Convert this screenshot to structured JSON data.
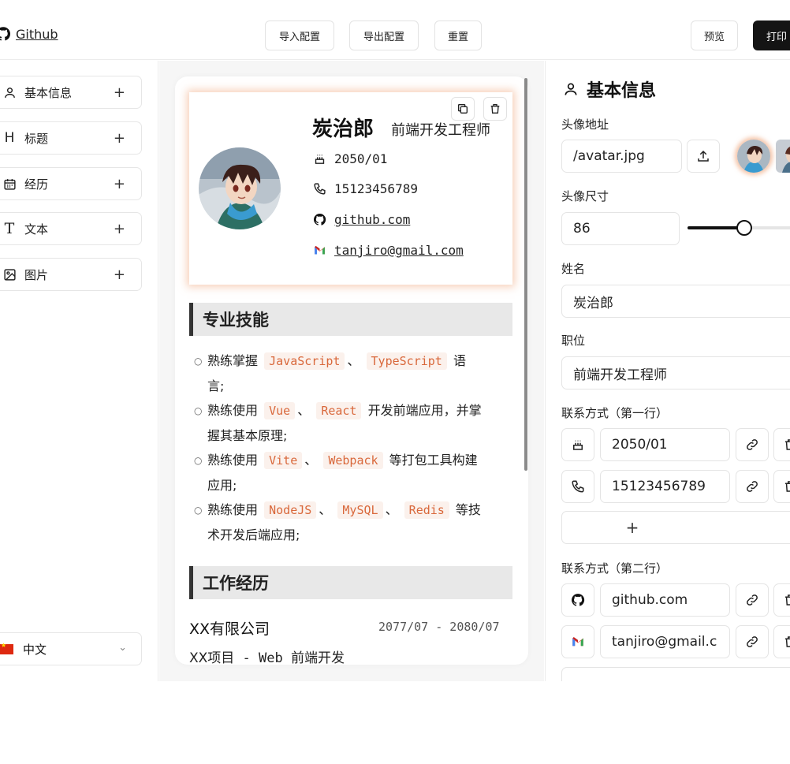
{
  "header": {
    "github_label": "Github",
    "import_label": "导入配置",
    "export_label": "导出配置",
    "reset_label": "重置",
    "preview_label": "预览",
    "print_label": "打印"
  },
  "sidebar": {
    "items": [
      {
        "label": "基本信息",
        "icon": "user-icon"
      },
      {
        "label": "标题",
        "icon": "heading-icon"
      },
      {
        "label": "经历",
        "icon": "calendar-icon"
      },
      {
        "label": "文本",
        "icon": "text-icon"
      },
      {
        "label": "图片",
        "icon": "image-icon"
      }
    ],
    "language": "中文"
  },
  "resume": {
    "name": "炭治郎",
    "title": "前端开发工程师",
    "birth": "2050/01",
    "phone": "15123456789",
    "github": "github.com",
    "email": "tanjiro@gmail.com",
    "skills_heading": "专业技能",
    "skills": [
      {
        "pre": "熟练掌握",
        "t1": "JavaScript",
        "sep": "、",
        "t2": "TypeScript",
        "post1": "语",
        "post2": "言;"
      },
      {
        "pre": "熟练使用",
        "t1": "Vue",
        "sep": "、",
        "t2": "React",
        "post1": "开发前端应用，并掌",
        "post2": "握其基本原理;"
      },
      {
        "pre": "熟练使用",
        "t1": "Vite",
        "sep": "、",
        "t2": "Webpack",
        "post1": "等打包工具构建",
        "post2": "应用;"
      },
      {
        "pre": "熟练使用",
        "t1": "NodeJS",
        "sep": "、",
        "t2": "MySQL",
        "sep2": "、",
        "t3": "Redis",
        "post1": "等技",
        "post2": "术开发后端应用;"
      }
    ],
    "work_heading": "工作经历",
    "work": {
      "company": "XX有限公司",
      "date": "2077/07 - 2080/07",
      "project": "XX项目",
      "dash": " - Web ",
      "role": "前端开发"
    }
  },
  "editor": {
    "panel_title": "基本信息",
    "avatar_label": "头像地址",
    "avatar_value": "/avatar.jpg",
    "size_label": "头像尺寸",
    "size_value": "86",
    "size_fraction": 0.36,
    "name_label": "姓名",
    "name_value": "炭治郎",
    "title_label": "职位",
    "title_value": "前端开发工程师",
    "row1_label": "联系方式（第一行）",
    "row1": [
      "2050/01",
      "15123456789"
    ],
    "row2_label": "联系方式（第二行）",
    "row2": [
      "github.com",
      "tanjiro@gmail.c"
    ],
    "plus": "+"
  }
}
